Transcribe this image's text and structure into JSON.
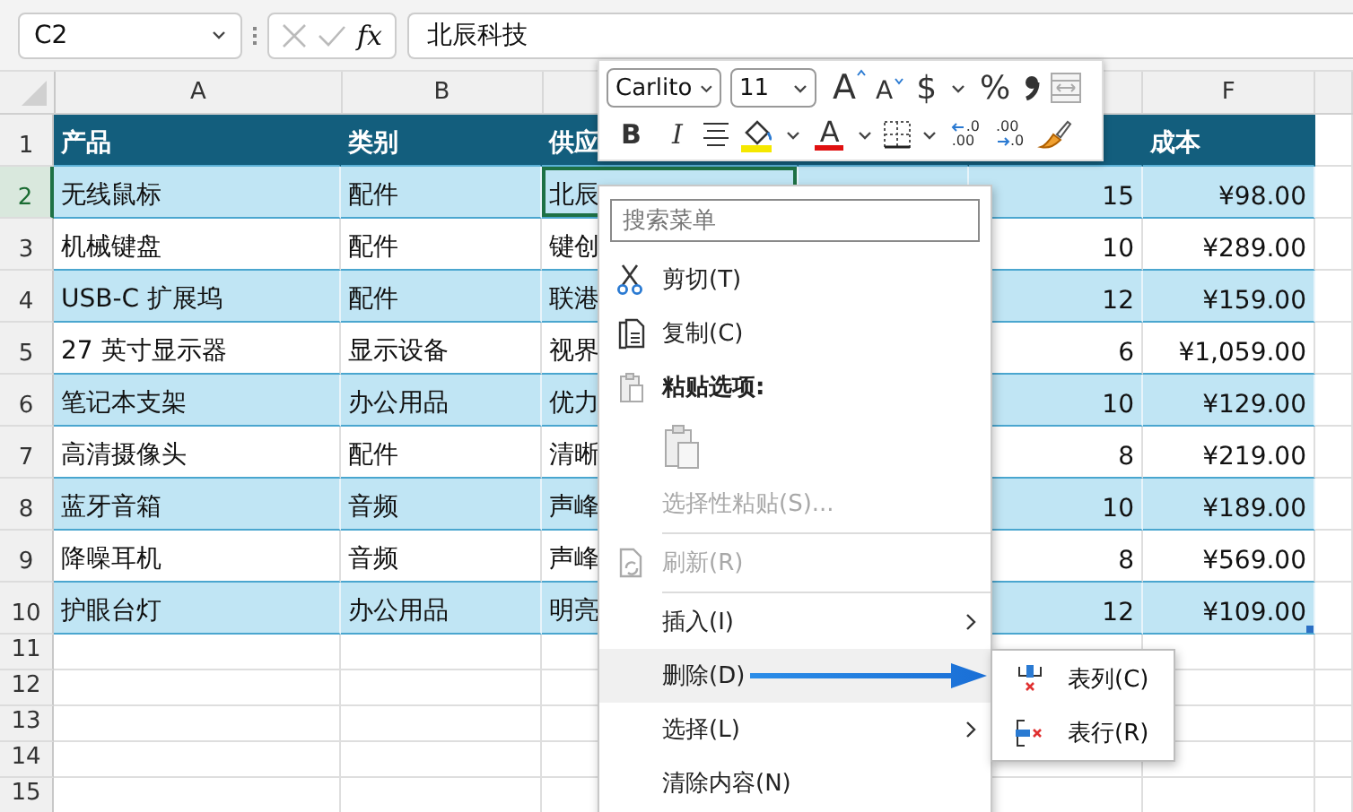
{
  "formula_bar": {
    "name_box": "C2",
    "function_label": "fx",
    "formula": "北辰科技"
  },
  "grid": {
    "column_headers": [
      "A",
      "B",
      "F"
    ],
    "rows": [
      {
        "number": "1",
        "kind": "header",
        "selected": false,
        "cells": {
          "A": "产品",
          "B": "类别",
          "C": "供应",
          "F": "成本"
        }
      },
      {
        "number": "2",
        "kind": "data",
        "banded": true,
        "selected": true,
        "cells": {
          "A": "无线鼠标",
          "B": "配件",
          "C": "北辰",
          "E": "15",
          "F": "¥98.00"
        }
      },
      {
        "number": "3",
        "kind": "data",
        "banded": false,
        "selected": false,
        "cells": {
          "A": "机械键盘",
          "B": "配件",
          "C": "键创",
          "E": "10",
          "F": "¥289.00"
        }
      },
      {
        "number": "4",
        "kind": "data",
        "banded": true,
        "selected": false,
        "cells": {
          "A": "USB-C 扩展坞",
          "B": "配件",
          "C": "联港",
          "E": "12",
          "F": "¥159.00"
        }
      },
      {
        "number": "5",
        "kind": "data",
        "banded": false,
        "selected": false,
        "cells": {
          "A": "27 英寸显示器",
          "B": "显示设备",
          "C": "视界",
          "E": "6",
          "F": "¥1,059.00"
        }
      },
      {
        "number": "6",
        "kind": "data",
        "banded": true,
        "selected": false,
        "cells": {
          "A": "笔记本支架",
          "B": "办公用品",
          "C": "优力",
          "E": "10",
          "F": "¥129.00"
        }
      },
      {
        "number": "7",
        "kind": "data",
        "banded": false,
        "selected": false,
        "cells": {
          "A": "高清摄像头",
          "B": "配件",
          "C": "清晰",
          "E": "8",
          "F": "¥219.00"
        }
      },
      {
        "number": "8",
        "kind": "data",
        "banded": true,
        "selected": false,
        "cells": {
          "A": "蓝牙音箱",
          "B": "音频",
          "C": "声峰",
          "E": "10",
          "F": "¥189.00"
        }
      },
      {
        "number": "9",
        "kind": "data",
        "banded": false,
        "selected": false,
        "cells": {
          "A": "降噪耳机",
          "B": "音频",
          "C": "声峰",
          "E": "8",
          "F": "¥569.00"
        }
      },
      {
        "number": "10",
        "kind": "data",
        "banded": true,
        "selected": false,
        "cells": {
          "A": "护眼台灯",
          "B": "办公用品",
          "C": "明亮",
          "E": "12",
          "F": "¥109.00"
        }
      },
      {
        "number": "11",
        "kind": "empty",
        "selected": false
      },
      {
        "number": "12",
        "kind": "empty",
        "selected": false
      },
      {
        "number": "13",
        "kind": "empty",
        "selected": false
      },
      {
        "number": "14",
        "kind": "empty",
        "selected": false
      },
      {
        "number": "15",
        "kind": "empty",
        "selected": false
      }
    ]
  },
  "mini_toolbar": {
    "font": "Carlito",
    "size": "11",
    "row1": [
      {
        "kind": "grow",
        "label": "A"
      },
      {
        "kind": "shrink",
        "label": "A"
      },
      {
        "kind": "text",
        "label": "$"
      },
      {
        "kind": "caret"
      },
      {
        "kind": "text",
        "label": "%"
      },
      {
        "kind": "comma"
      },
      {
        "kind": "merge"
      }
    ],
    "row2": [
      {
        "kind": "bold",
        "label": "B"
      },
      {
        "kind": "italic",
        "label": "I"
      },
      {
        "kind": "align"
      },
      {
        "kind": "fill"
      },
      {
        "kind": "caret"
      },
      {
        "kind": "font-color",
        "label": "A"
      },
      {
        "kind": "caret"
      },
      {
        "kind": "borders"
      },
      {
        "kind": "caret"
      },
      {
        "kind": "decimal-less",
        "lines": [
          ".0",
          ".00"
        ]
      },
      {
        "kind": "decimal-more",
        "lines": [
          ".00",
          ".0"
        ]
      },
      {
        "kind": "painter"
      }
    ]
  },
  "context_menu": {
    "items": [
      {
        "kind": "search",
        "placeholder": "搜索菜单"
      },
      {
        "kind": "item",
        "label": "剪切(T)",
        "disabled": false,
        "selected": false,
        "submenu": false
      },
      {
        "kind": "item",
        "label": "复制(C)",
        "disabled": false,
        "selected": false,
        "submenu": false
      },
      {
        "kind": "heading",
        "label": "粘贴选项:"
      },
      {
        "kind": "paste-option"
      },
      {
        "kind": "item",
        "label": "选择性粘贴(S)...",
        "disabled": true,
        "selected": false,
        "submenu": false
      },
      {
        "kind": "separator"
      },
      {
        "kind": "item",
        "label": "刷新(R)",
        "disabled": true,
        "selected": false,
        "submenu": false
      },
      {
        "kind": "separator"
      },
      {
        "kind": "item",
        "label": "插入(I)",
        "disabled": false,
        "selected": false,
        "submenu": true
      },
      {
        "kind": "item",
        "label": "删除(D)",
        "disabled": false,
        "selected": true,
        "submenu": false
      },
      {
        "kind": "item",
        "label": "选择(L)",
        "disabled": false,
        "selected": false,
        "submenu": true
      },
      {
        "kind": "item",
        "label": "清除内容(N)",
        "disabled": false,
        "selected": false,
        "submenu": false
      }
    ]
  },
  "submenu": {
    "items": [
      {
        "label": "表列(C)"
      },
      {
        "label": "表行(R)"
      }
    ]
  }
}
